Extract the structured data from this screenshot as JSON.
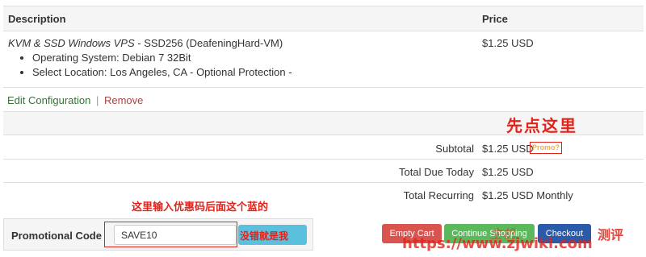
{
  "table": {
    "headers": {
      "description": "Description",
      "price": "Price"
    },
    "item": {
      "title_italic": "KVM & SSD Windows VPS",
      "title_rest": " - SSD256 (DeafeningHard-VM)",
      "options": [
        "Operating System: Debian 7 32Bit",
        "Select Location: Los Angeles, CA - Optional Protection -"
      ],
      "price": "$1.25 USD",
      "edit_label": "Edit Configuration",
      "separator": "|",
      "remove_label": "Remove"
    }
  },
  "totals": {
    "subtotal_label": "Subtotal",
    "subtotal_value": "$1.25 USD",
    "promo_tag": "Promo?",
    "due_today_label": "Total Due Today",
    "due_today_value": "$1.25 USD",
    "recurring_label": "Total Recurring",
    "recurring_value": "$1.25 USD Monthly"
  },
  "annotations": {
    "click_here_first": "先点这里",
    "enter_code_note": "这里输入优惠码后面这个蓝的",
    "button_overlay": "没错就是我"
  },
  "promo": {
    "label": "Promotional Code",
    "value": "SAVE10"
  },
  "buttons": {
    "empty_cart": "Empty Cart",
    "continue_shopping": "Continue Shopping",
    "checkout": "Checkout"
  },
  "watermark": {
    "url": "https://www.zjwiki.com",
    "text_left": "主机",
    "text_right": "测评"
  },
  "colors": {
    "edit_link": "#3b6e3b",
    "remove_link": "#a94442",
    "annotation_red": "#e2231a",
    "empty_cart_bg": "#d9534f",
    "continue_bg": "#5cb85c",
    "checkout_bg": "#2a5aa8",
    "apply_bg": "#5bc0de"
  }
}
